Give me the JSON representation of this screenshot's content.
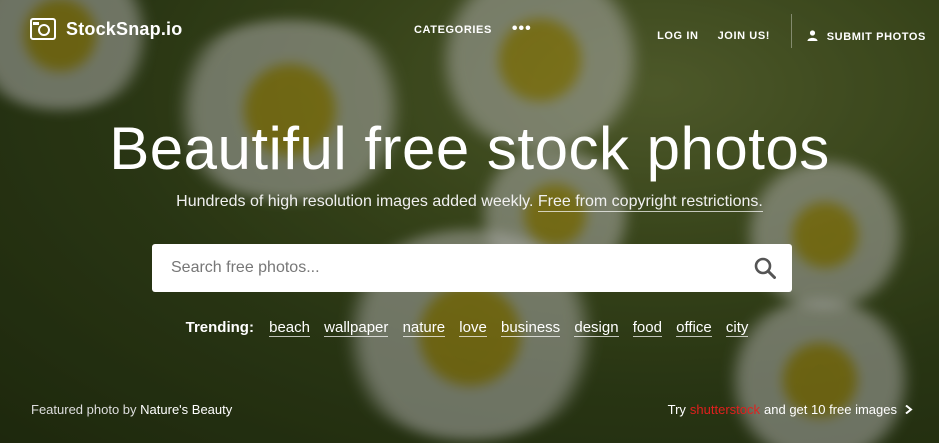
{
  "header": {
    "logo_text": "StockSnap.io",
    "categories_label": "CATEGORIES",
    "more_label": "•••",
    "login_label": "LOG IN",
    "join_label": "JOIN US!",
    "submit_label": "SUBMIT PHOTOS"
  },
  "hero": {
    "title": "Beautiful free stock photos",
    "subtitle_plain": "Hundreds of high resolution images added weekly.",
    "subtitle_link": "Free from copyright restrictions."
  },
  "search": {
    "placeholder": "Search free photos..."
  },
  "trending": {
    "label": "Trending:",
    "tags": [
      "beach",
      "wallpaper",
      "nature",
      "love",
      "business",
      "design",
      "food",
      "office",
      "city"
    ]
  },
  "footer": {
    "featured_prefix": "Featured photo by",
    "featured_author": "Nature's Beauty",
    "promo_try": "Try",
    "promo_brand": "shutterstock",
    "promo_rest": "and get 10 free images"
  },
  "colors": {
    "promo_brand": "#e0201e",
    "search_bg": "#ffffff"
  }
}
